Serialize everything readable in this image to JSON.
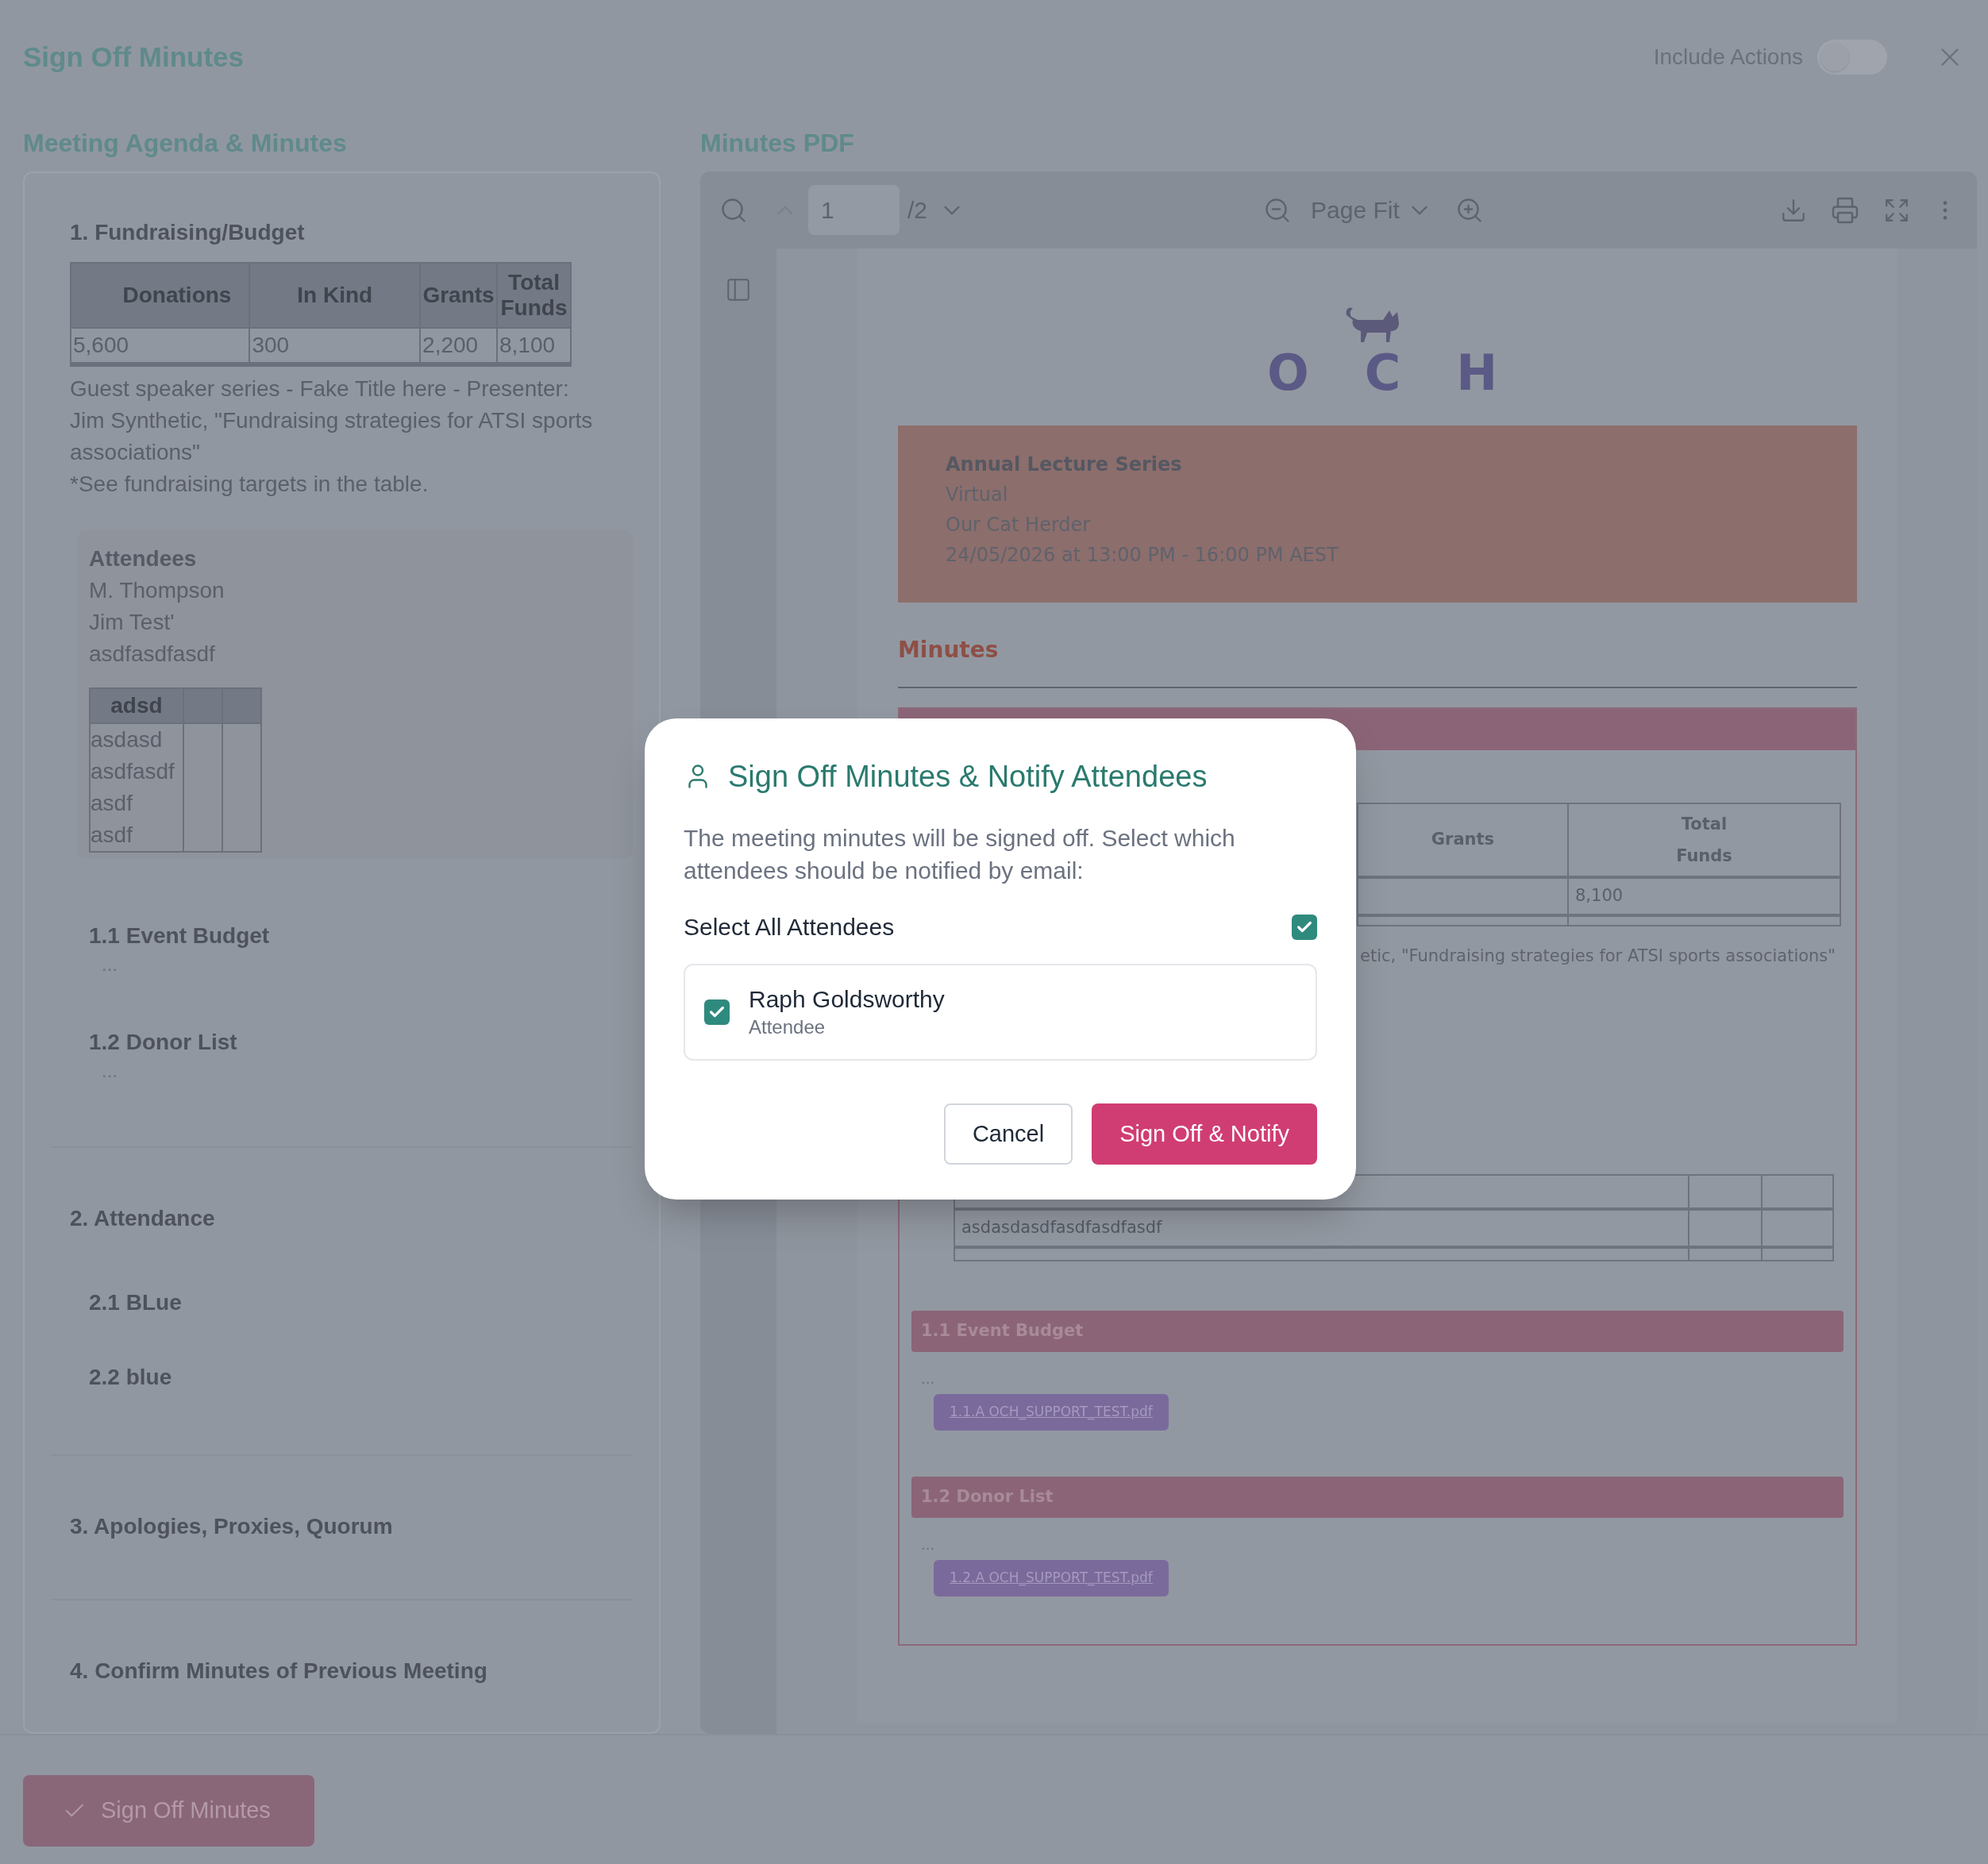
{
  "header": {
    "title": "Sign Off Minutes",
    "include_actions": {
      "label": "Include Actions",
      "on": false
    }
  },
  "agenda": {
    "heading": "Meeting Agenda & Minutes",
    "sections": [
      {
        "title": "1. Fundraising/Budget",
        "table": {
          "columns": [
            "Donations",
            "In Kind",
            "Grants",
            "Total Funds"
          ],
          "rows": [
            [
              "5,600",
              "300",
              "2,200",
              "8,100"
            ]
          ]
        },
        "notes": [
          "Guest speaker series - Fake Title here - Presenter: Jim Synthetic, \"Fundraising strategies for ATSI sports associations\"",
          "*See fundraising targets in the table."
        ],
        "attendees": {
          "heading": "Attendees",
          "names": [
            "M. Thompson",
            "Jim Test'",
            "asdfasdfasdf"
          ],
          "table": {
            "column_1": "adsd",
            "rows": [
              "asdasd",
              "asdfasdf",
              "asdf",
              "asdf"
            ]
          }
        },
        "children": [
          {
            "title": "1.1 Event Budget",
            "body": "..."
          },
          {
            "title": "1.2 Donor List",
            "body": "..."
          }
        ]
      },
      {
        "title": "2. Attendance",
        "children": [
          {
            "title": "2.1 BLue"
          },
          {
            "title": "2.2 blue"
          }
        ]
      },
      {
        "title": "3. Apologies, Proxies, Quorum"
      },
      {
        "title": "4. Confirm Minutes of Previous Meeting"
      }
    ]
  },
  "pdf": {
    "heading": "Minutes PDF",
    "toolbar": {
      "page": "1",
      "page_count": "/2",
      "zoom": "Page Fit"
    },
    "document": {
      "logo": "OCH",
      "event": {
        "title": "Annual Lecture Series",
        "lines": [
          "Virtual",
          "Our Cat Herder",
          "24/05/2026 at 13:00 PM - 16:00 PM AEST"
        ]
      },
      "minutes_heading": "Minutes",
      "budget_table": {
        "column_1": "Grants",
        "column_2": "Total Funds",
        "total": "8,100"
      },
      "note": "etic, \"Fundraising strategies for ATSI sports associations\"",
      "text_table_row": "asdasdasdfasdfasdfasdf",
      "subsections": [
        {
          "title": "1.1 Event Budget",
          "body": "...",
          "attachment": "1.1.A OCH_SUPPORT_TEST.pdf"
        },
        {
          "title": "1.2 Donor List",
          "body": "...",
          "attachment": "1.2.A OCH_SUPPORT_TEST.pdf"
        }
      ]
    }
  },
  "dialog": {
    "title": "Sign Off Minutes & Notify Attendees",
    "message": "The meeting minutes will be signed off. Select which attendees should be notified by email:",
    "select_all": {
      "label": "Select All Attendees",
      "checked": true
    },
    "attendees": [
      {
        "name": "Raph Goldsworthy",
        "role": "Attendee",
        "checked": true
      }
    ],
    "buttons": [
      {
        "label": "Cancel",
        "kind": "secondary"
      },
      {
        "label": "Sign Off & Notify",
        "kind": "primary"
      }
    ]
  },
  "footer": {
    "button": "Sign Off Minutes"
  }
}
